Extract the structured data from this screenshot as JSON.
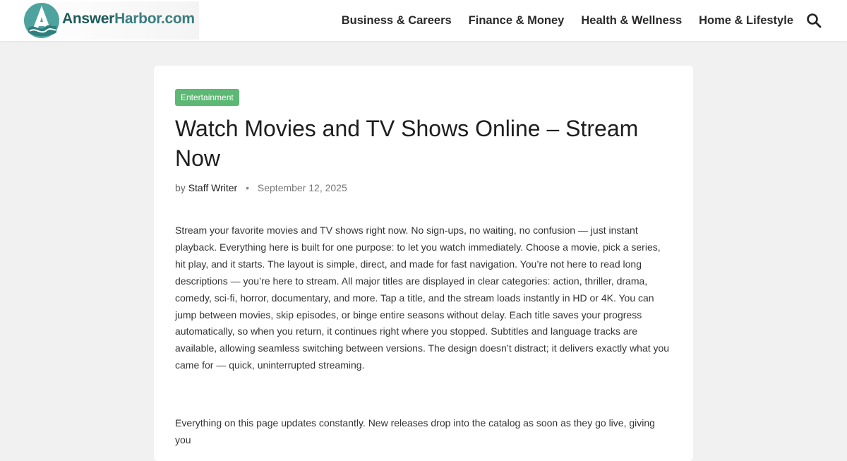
{
  "header": {
    "logo_text_primary": "Answer",
    "logo_text_secondary": "Harbor.com",
    "nav": [
      {
        "label": "Business & Careers"
      },
      {
        "label": "Finance & Money"
      },
      {
        "label": "Health & Wellness"
      },
      {
        "label": "Home & Lifestyle"
      }
    ],
    "search_icon": "search-icon"
  },
  "article": {
    "category": "Entertainment",
    "title": "Watch Movies and TV Shows Online – Stream Now",
    "by_label": "by",
    "author": "Staff Writer",
    "separator": "•",
    "date": "September 12, 2025",
    "paragraphs": [
      "Stream your favorite movies and TV shows right now. No sign-ups, no waiting, no confusion — just instant playback. Everything here is built for one purpose: to let you watch immediately. Choose a movie, pick a series, hit play, and it starts. The layout is simple, direct, and made for fast navigation. You’re not here to read long descriptions — you’re here to stream. All major titles are displayed in clear categories: action, thriller, drama, comedy, sci-fi, horror, documentary, and more. Tap a title, and the stream loads instantly in HD or 4K. You can jump between movies, skip episodes, or binge entire seasons without delay. Each title saves your progress automatically, so when you return, it continues right where you stopped. Subtitles and language tracks are available, allowing seamless switching between versions. The design doesn’t distract; it delivers exactly what you came for — quick, uninterrupted streaming.",
      "Everything on this page updates constantly. New releases drop into the catalog as soon as they go live, giving you"
    ]
  },
  "colors": {
    "background": "#f1f1f1",
    "card": "#ffffff",
    "badge": "#5cb874",
    "logo_dark": "#1f5a5a",
    "logo_teal": "#3b7d80"
  }
}
